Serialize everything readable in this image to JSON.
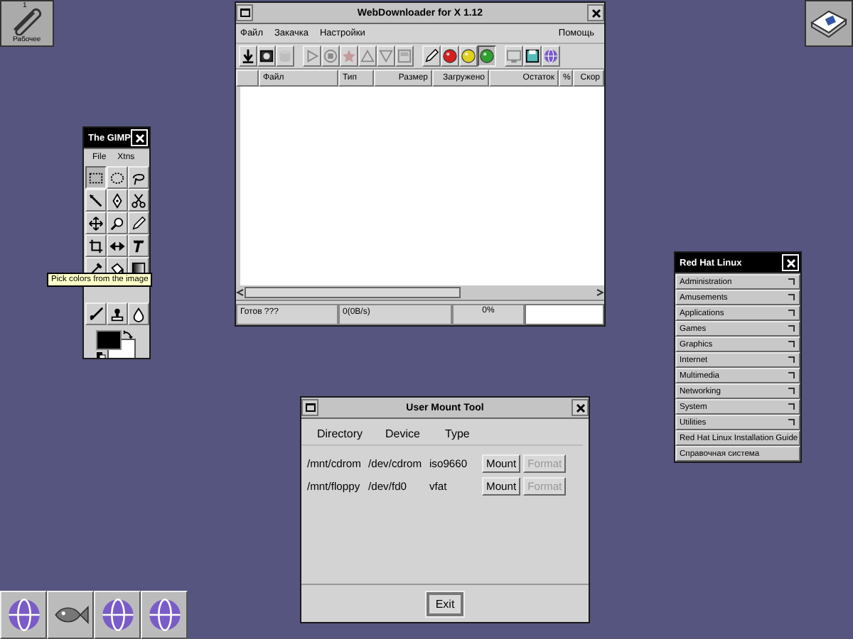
{
  "desktop": {
    "icons": [
      {
        "kind": "clip",
        "number": "1",
        "label": "Рабочее"
      },
      {
        "kind": "book"
      }
    ],
    "taskbar": [
      {
        "kind": "globe"
      },
      {
        "kind": "fish"
      },
      {
        "kind": "globe"
      },
      {
        "kind": "globe"
      }
    ]
  },
  "downloader": {
    "title": "WebDownloader for X 1.12",
    "menu": [
      "Файл",
      "Закачка",
      "Настройки"
    ],
    "help_menu": "Помощь",
    "toolbar": [
      [
        {
          "kind": "download",
          "disabled": false
        },
        {
          "kind": "box",
          "disabled": false
        },
        {
          "kind": "cylinder",
          "disabled": true
        }
      ],
      [
        {
          "kind": "play",
          "disabled": true
        },
        {
          "kind": "stop",
          "disabled": true
        },
        {
          "kind": "star",
          "disabled": true
        },
        {
          "kind": "up",
          "disabled": true
        },
        {
          "kind": "down",
          "disabled": true
        },
        {
          "kind": "image",
          "disabled": true
        }
      ],
      [
        {
          "kind": "pencil",
          "disabled": false
        },
        {
          "kind": "red",
          "disabled": false
        },
        {
          "kind": "yellow",
          "disabled": false
        },
        {
          "kind": "green",
          "disabled": false,
          "pressed": true
        }
      ],
      [
        {
          "kind": "monitor",
          "disabled": true
        },
        {
          "kind": "floppy",
          "disabled": false
        },
        {
          "kind": "globe",
          "disabled": false
        }
      ]
    ],
    "columns": [
      "Файл",
      "Тип",
      "Размер",
      "Загружено",
      "Остаток",
      "%",
      "Скор"
    ],
    "status": [
      "Готов ???",
      "0(0B/s)"
    ],
    "progress": {
      "level": 0,
      "reading": "0%"
    }
  },
  "gimp": {
    "title": "The GIMP",
    "menu": [
      "File",
      "Xtns"
    ],
    "tools_top": [
      {
        "kind": "rect",
        "selected": true
      },
      {
        "kind": "ellipse",
        "selected": false
      },
      {
        "kind": "lasso",
        "selected": false
      },
      {
        "kind": "wand",
        "selected": false
      },
      {
        "kind": "pen",
        "selected": false
      },
      {
        "kind": "scissors",
        "selected": false
      },
      {
        "kind": "move",
        "selected": false
      },
      {
        "kind": "magnifier",
        "selected": false
      },
      {
        "kind": "pencil",
        "selected": false
      },
      {
        "kind": "crop",
        "selected": false
      },
      {
        "kind": "flip",
        "selected": false
      },
      {
        "kind": "text",
        "selected": false
      },
      {
        "kind": "eyedropper",
        "selected": false
      },
      {
        "kind": "bucket",
        "selected": false
      },
      {
        "kind": "gradient",
        "selected": false
      }
    ],
    "tools_bottom": [
      {
        "kind": "brush",
        "selected": false
      },
      {
        "kind": "stamp",
        "selected": false
      },
      {
        "kind": "drop",
        "selected": false
      }
    ],
    "tooltip": "Pick colors from the image"
  },
  "redhat_menu": {
    "title": "Red Hat Linux",
    "items": [
      {
        "label": "Administration",
        "submenu": true
      },
      {
        "label": "Amusements",
        "submenu": true
      },
      {
        "label": "Applications",
        "submenu": true
      },
      {
        "label": "Games",
        "submenu": true
      },
      {
        "label": "Graphics",
        "submenu": true
      },
      {
        "label": "Internet",
        "submenu": true
      },
      {
        "label": "Multimedia",
        "submenu": true
      },
      {
        "label": "Networking",
        "submenu": true
      },
      {
        "label": "System",
        "submenu": true
      },
      {
        "label": "Utilities",
        "submenu": true
      },
      {
        "label": "Red Hat Linux Installation Guide",
        "submenu": false
      },
      {
        "label": "Справочная система",
        "submenu": false
      }
    ]
  },
  "mount_tool": {
    "title": "User Mount Tool",
    "columns": [
      "Directory",
      "Device",
      "Type"
    ],
    "rows": [
      {
        "directory": "/mnt/cdrom",
        "device": "/dev/cdrom",
        "type": "iso9660",
        "mount": "Mount",
        "format": "Format",
        "format_disabled": true
      },
      {
        "directory": "/mnt/floppy",
        "device": "/dev/fd0",
        "type": "vfat",
        "mount": "Mount",
        "format": "Format",
        "format_disabled": true
      }
    ],
    "exit": "Exit"
  }
}
